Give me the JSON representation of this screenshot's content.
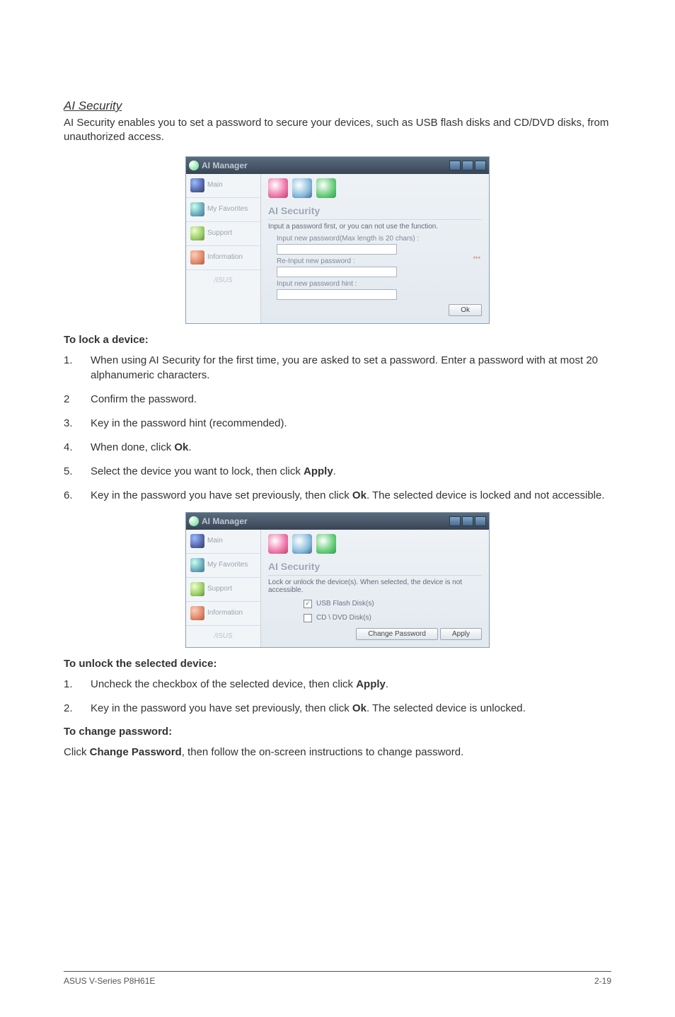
{
  "heading": "AI Security",
  "intro": "AI Security enables you to set a password to secure your devices, such as USB flash disks and CD/DVD disks, from unauthorized access.",
  "lock": {
    "title": "To lock a device:",
    "steps": [
      "When using AI Security for the first time, you are asked to set a password. Enter a password with at most 20 alphanumeric characters.",
      "Confirm the password.",
      "Key in the password hint (recommended).",
      "When done, click Ok.",
      "Select the device you want to lock, then click Apply.",
      "Key in the password you have set previously, then click Ok. The selected device is locked and not accessible."
    ],
    "bold": {
      "ok": "Ok",
      "apply": "Apply"
    }
  },
  "unlock": {
    "title": "To unlock the selected device:",
    "steps": [
      "Uncheck the checkbox of the selected device, then click Apply.",
      "Key in the password you have set previously, then click Ok. The selected device is unlocked."
    ]
  },
  "change": {
    "title": "To change password:",
    "text_pre": "Click ",
    "text_bold": "Change Password",
    "text_post": ", then follow the on-screen instructions to change password."
  },
  "shot1": {
    "app_title": "AI Manager",
    "sidebar": [
      "Main",
      "My Favorites",
      "Support",
      "Information"
    ],
    "section_title": "AI Security",
    "desc": "Input a password first, or you can not use the function.",
    "field1": "Input new password(Max length is 20 chars) :",
    "field2": "Re-Input new password :",
    "field3": "Input new password hint :",
    "ok": "Ok"
  },
  "shot2": {
    "app_title": "AI Manager",
    "sidebar": [
      "Main",
      "My Favorites",
      "Support",
      "Information"
    ],
    "section_title": "AI Security",
    "desc": "Lock or unlock the device(s). When selected, the device is not accessible.",
    "check1": "USB Flash Disk(s)",
    "check2": "CD \\ DVD Disk(s)",
    "btn_change": "Change Password",
    "btn_apply": "Apply"
  },
  "footer": {
    "left": "ASUS V-Series P8H61E",
    "right": "2-19"
  }
}
